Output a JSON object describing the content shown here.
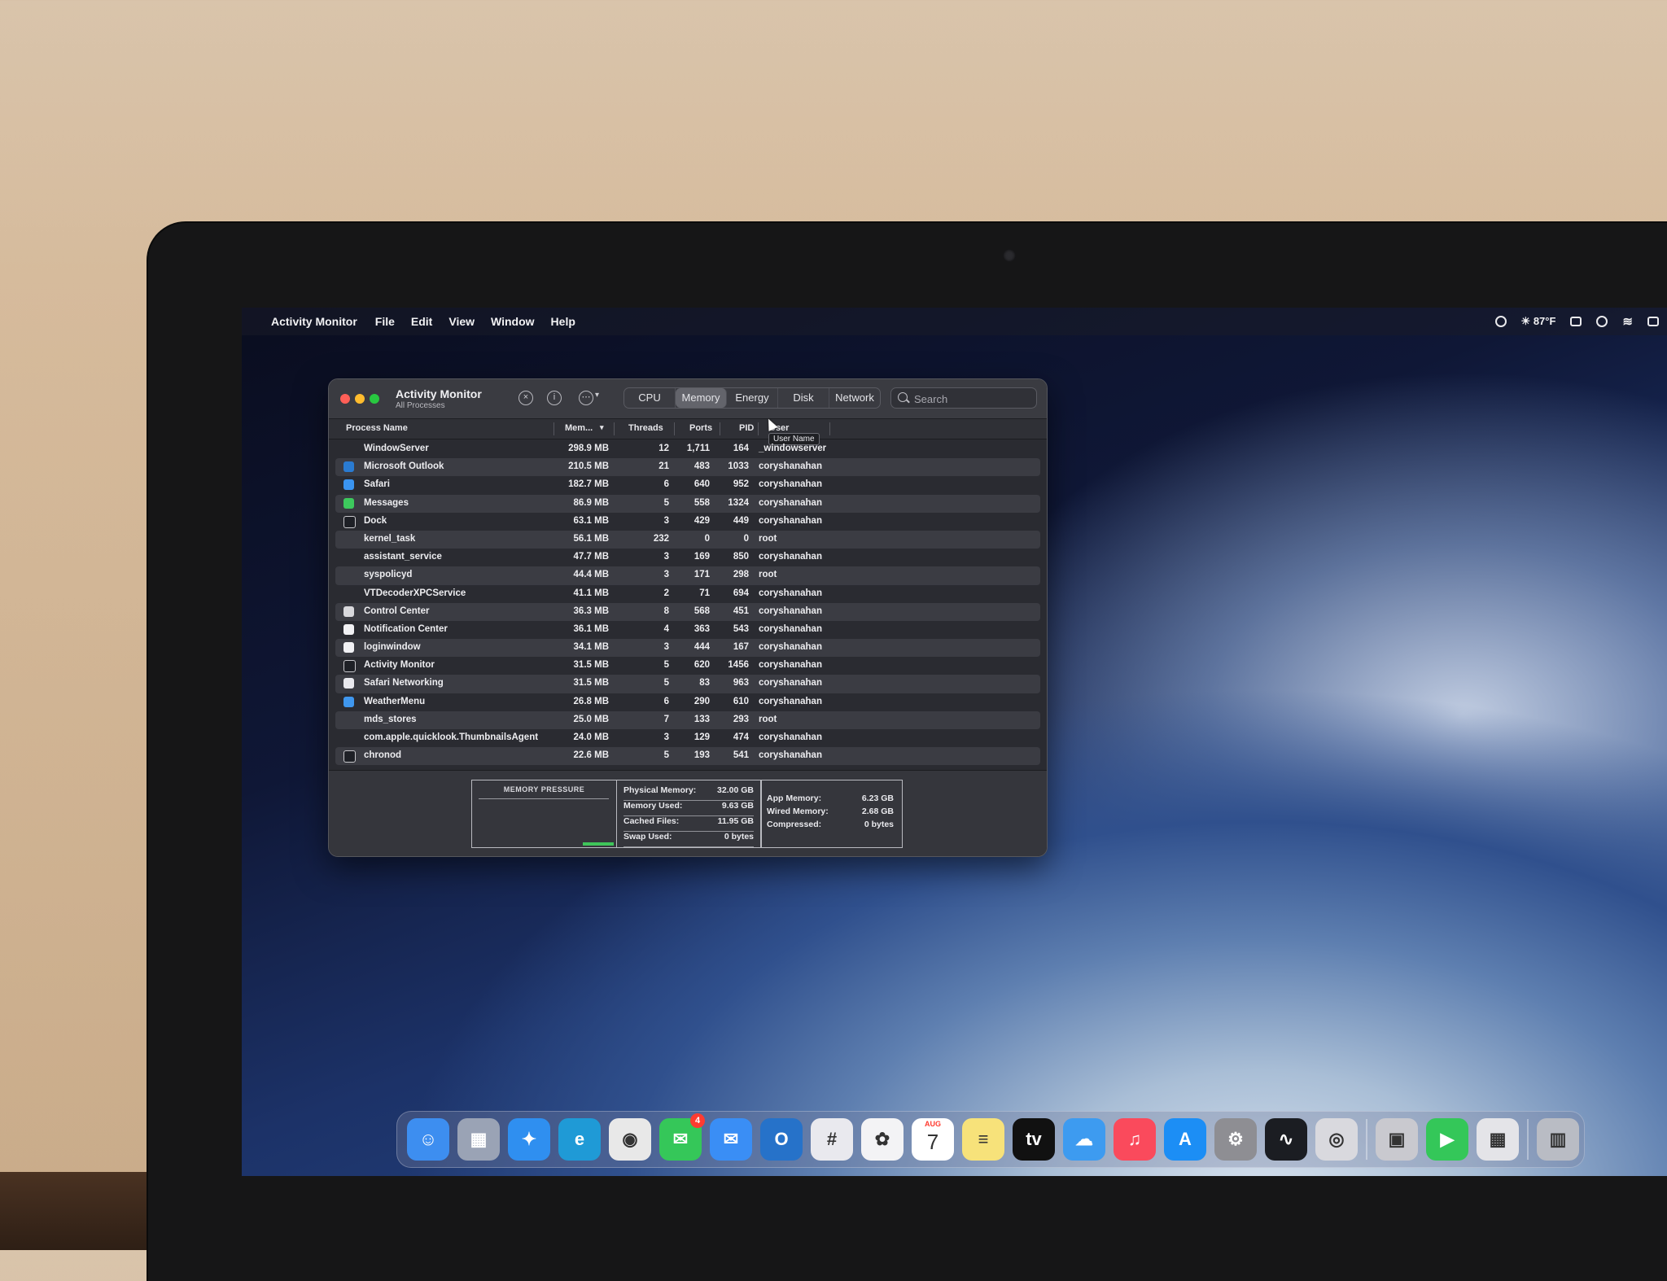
{
  "menubar": {
    "app_name": "Activity Monitor",
    "menus": [
      "File",
      "Edit",
      "View",
      "Window",
      "Help"
    ],
    "weather": "☀ 87°F"
  },
  "window": {
    "title": "Activity Monitor",
    "subtitle": "All Processes",
    "tabs": [
      "CPU",
      "Memory",
      "Energy",
      "Disk",
      "Network"
    ],
    "active_tab": "Memory",
    "search": {
      "placeholder": "Search",
      "value": ""
    },
    "columns": {
      "name": "Process Name",
      "memory": "Mem...",
      "threads": "Threads",
      "ports": "Ports",
      "pid": "PID",
      "user": "User"
    },
    "tooltip": "User Name",
    "processes": [
      {
        "name": "WindowServer",
        "memory": "298.9 MB",
        "threads": "12",
        "ports": "1,711",
        "pid": "164",
        "user": "_windowserver",
        "icon": "none"
      },
      {
        "name": "Microsoft Outlook",
        "memory": "210.5 MB",
        "threads": "21",
        "ports": "483",
        "pid": "1033",
        "user": "coryshanahan",
        "icon": "outlook-icon"
      },
      {
        "name": "Safari",
        "memory": "182.7 MB",
        "threads": "6",
        "ports": "640",
        "pid": "952",
        "user": "coryshanahan",
        "icon": "safari-icon"
      },
      {
        "name": "Messages",
        "memory": "86.9 MB",
        "threads": "5",
        "ports": "558",
        "pid": "1324",
        "user": "coryshanahan",
        "icon": "messages-icon"
      },
      {
        "name": "Dock",
        "memory": "63.1 MB",
        "threads": "3",
        "ports": "429",
        "pid": "449",
        "user": "coryshanahan",
        "icon": "dock-icon"
      },
      {
        "name": "kernel_task",
        "memory": "56.1 MB",
        "threads": "232",
        "ports": "0",
        "pid": "0",
        "user": "root",
        "icon": "none"
      },
      {
        "name": "assistant_service",
        "memory": "47.7 MB",
        "threads": "3",
        "ports": "169",
        "pid": "850",
        "user": "coryshanahan",
        "icon": "none"
      },
      {
        "name": "syspolicyd",
        "memory": "44.4 MB",
        "threads": "3",
        "ports": "171",
        "pid": "298",
        "user": "root",
        "icon": "none"
      },
      {
        "name": "VTDecoderXPCService",
        "memory": "41.1 MB",
        "threads": "2",
        "ports": "71",
        "pid": "694",
        "user": "coryshanahan",
        "icon": "none"
      },
      {
        "name": "Control Center",
        "memory": "36.3 MB",
        "threads": "8",
        "ports": "568",
        "pid": "451",
        "user": "coryshanahan",
        "icon": "control-center-icon"
      },
      {
        "name": "Notification Center",
        "memory": "36.1 MB",
        "threads": "4",
        "ports": "363",
        "pid": "543",
        "user": "coryshanahan",
        "icon": "notification-center-icon"
      },
      {
        "name": "loginwindow",
        "memory": "34.1 MB",
        "threads": "3",
        "ports": "444",
        "pid": "167",
        "user": "coryshanahan",
        "icon": "loginwindow-icon"
      },
      {
        "name": "Activity Monitor",
        "memory": "31.5 MB",
        "threads": "5",
        "ports": "620",
        "pid": "1456",
        "user": "coryshanahan",
        "icon": "activity-monitor-icon"
      },
      {
        "name": "Safari Networking",
        "memory": "31.5 MB",
        "threads": "5",
        "ports": "83",
        "pid": "963",
        "user": "coryshanahan",
        "icon": "shield-icon"
      },
      {
        "name": "WeatherMenu",
        "memory": "26.8 MB",
        "threads": "6",
        "ports": "290",
        "pid": "610",
        "user": "coryshanahan",
        "icon": "weather-icon"
      },
      {
        "name": "mds_stores",
        "memory": "25.0 MB",
        "threads": "7",
        "ports": "133",
        "pid": "293",
        "user": "root",
        "icon": "none"
      },
      {
        "name": "com.apple.quicklook.ThumbnailsAgent",
        "memory": "24.0 MB",
        "threads": "3",
        "ports": "129",
        "pid": "474",
        "user": "coryshanahan",
        "icon": "none"
      },
      {
        "name": "chronod",
        "memory": "22.6 MB",
        "threads": "5",
        "ports": "193",
        "pid": "541",
        "user": "coryshanahan",
        "icon": "chronod-icon"
      }
    ],
    "footer": {
      "memory_pressure_label": "MEMORY PRESSURE",
      "memory_pressure_level": 0.05,
      "stats_left": [
        {
          "label": "Physical Memory:",
          "value": "32.00 GB"
        },
        {
          "label": "Memory Used:",
          "value": "9.63 GB"
        },
        {
          "label": "Cached Files:",
          "value": "11.95 GB"
        },
        {
          "label": "Swap Used:",
          "value": "0 bytes"
        }
      ],
      "stats_right": [
        {
          "label": "App Memory:",
          "value": "6.23 GB"
        },
        {
          "label": "Wired Memory:",
          "value": "2.68 GB"
        },
        {
          "label": "Compressed:",
          "value": "0 bytes"
        }
      ]
    }
  },
  "dock": {
    "apps": [
      {
        "name": "finder-icon",
        "color": "#3d8ef0",
        "glyph": "☺"
      },
      {
        "name": "launchpad-icon",
        "color": "#9aa3b5",
        "glyph": "▦"
      },
      {
        "name": "safari-icon",
        "color": "#2f8ff0",
        "glyph": "✦"
      },
      {
        "name": "edge-icon",
        "color": "#1f9ad6",
        "glyph": "e"
      },
      {
        "name": "chrome-icon",
        "color": "#e8e8e8",
        "glyph": "◉"
      },
      {
        "name": "messages-icon",
        "color": "#35c759",
        "glyph": "✉",
        "badge": "4"
      },
      {
        "name": "mail-icon",
        "color": "#3a8ef5",
        "glyph": "✉"
      },
      {
        "name": "outlook-icon",
        "color": "#2672c9",
        "glyph": "O"
      },
      {
        "name": "slack-icon",
        "color": "#e9e9ee",
        "glyph": "#"
      },
      {
        "name": "photos-icon",
        "color": "#f3f3f5",
        "glyph": "✿"
      },
      {
        "name": "calendar-icon",
        "color": "#ffffff",
        "month": "AUG",
        "day": "7"
      },
      {
        "name": "notes-icon",
        "color": "#f7e27a",
        "glyph": "≡"
      },
      {
        "name": "apple-tv-icon",
        "color": "#111111",
        "glyph": "tv"
      },
      {
        "name": "weather-icon",
        "color": "#3d9bf0",
        "glyph": "☁"
      },
      {
        "name": "music-icon",
        "color": "#fa4a5c",
        "glyph": "♫"
      },
      {
        "name": "app-store-icon",
        "color": "#1c8ef5",
        "glyph": "A"
      },
      {
        "name": "system-preferences-icon",
        "color": "#8e8e93",
        "glyph": "⚙"
      },
      {
        "name": "activity-monitor-icon",
        "color": "#1b1d22",
        "glyph": "∿"
      },
      {
        "name": "screenshot-icon",
        "color": "#d9d9de",
        "glyph": "◎"
      },
      {
        "name": "preview-icon",
        "color": "#c9c9cf",
        "glyph": "▣"
      },
      {
        "name": "facetime-icon",
        "color": "#34c759",
        "glyph": "▶"
      },
      {
        "name": "calculator-icon",
        "color": "#e4e4e8",
        "glyph": "▦"
      },
      {
        "name": "trash-icon",
        "color": "#b9bcc4",
        "glyph": "▥"
      }
    ]
  }
}
